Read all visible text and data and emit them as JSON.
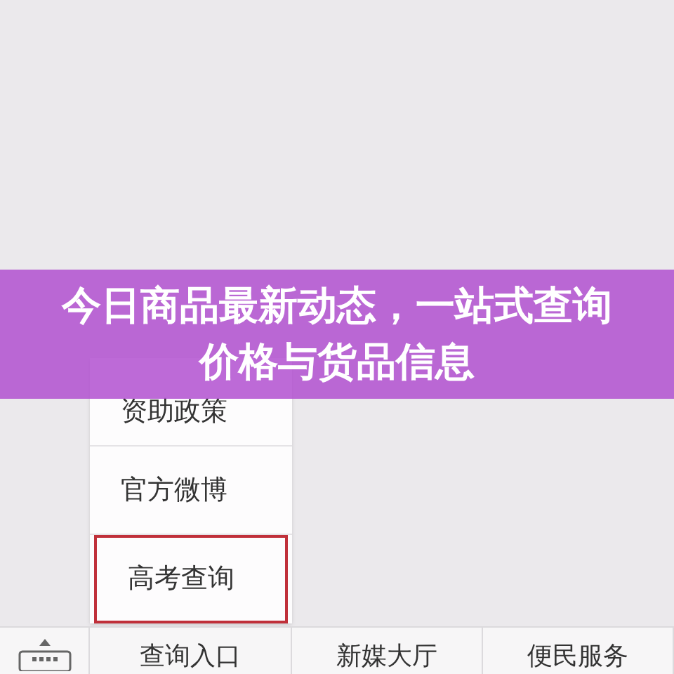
{
  "banner": {
    "title": "今日商品最新动态，一站式查询价格与货品信息"
  },
  "popup_menu": [
    {
      "label": "资助政策",
      "selected": false
    },
    {
      "label": "官方微博",
      "selected": false
    },
    {
      "label": "高考查询",
      "selected": true
    }
  ],
  "bottom_menu": [
    {
      "label": "查询入口"
    },
    {
      "label": "新媒大厅"
    },
    {
      "label": "便民服务"
    }
  ]
}
